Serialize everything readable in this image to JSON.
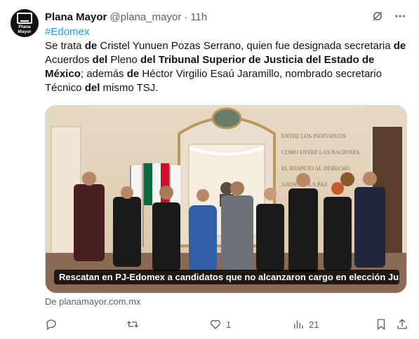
{
  "avatar": {
    "text_line1": "Plana",
    "text_line2": "Mayor"
  },
  "tweet": {
    "author_name": "Plana Mayor",
    "author_handle": "@plana_mayor",
    "separator": "·",
    "time": "11h",
    "hashtag": "#Edomex",
    "text_parts": [
      {
        "t": "Se trata ",
        "b": false
      },
      {
        "t": "de",
        "b": true
      },
      {
        "t": " Cristel Yunuen Pozas Serrano, quien fue designada secretaria ",
        "b": false
      },
      {
        "t": "de",
        "b": true
      },
      {
        "t": " Acuerdos ",
        "b": false
      },
      {
        "t": "del",
        "b": true
      },
      {
        "t": " Pleno ",
        "b": false
      },
      {
        "t": "del Tribunal Superior de Justicia del Estado de México",
        "b": true
      },
      {
        "t": "; además ",
        "b": false
      },
      {
        "t": "de",
        "b": true
      },
      {
        "t": " Héctor Virgilio Esaú Jaramillo, nombrado secretario Técnico ",
        "b": false
      },
      {
        "t": "del",
        "b": true
      },
      {
        "t": " mismo TSJ.",
        "b": false
      }
    ],
    "media_caption": "Rescatan en PJ-Edomex a candidatos que no alcanzaron cargo en elección Ju...",
    "wall_text": [
      "ENTRE LOS INDIVIDUOS",
      "COMO ENTRE LAS NACIONES",
      "EL RESPETO AL DERECHO",
      "AJENO ES LA PAZ"
    ],
    "source_label": "De planamayor.com.mx"
  },
  "actions": {
    "reply_count": "",
    "retweet_count": "",
    "like_count": "1",
    "views_count": "21"
  }
}
